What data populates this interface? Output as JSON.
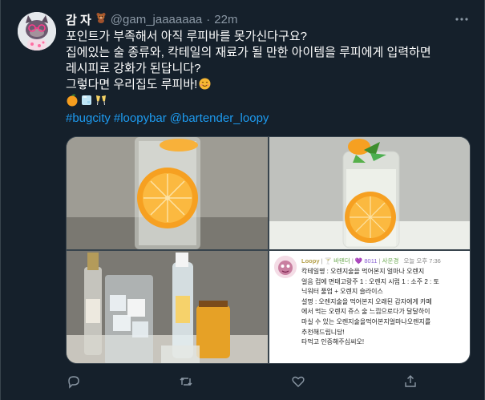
{
  "tweet": {
    "display_name": "감 자",
    "name_emoji": "bear-emoji",
    "handle": "@gam_jaaaaaaa",
    "separator": "·",
    "time": "22m",
    "lines": [
      "포인트가 부족해서 아직 루피바를 못가신다구요?",
      "집에있는 술 종류와, 칵테일의 재료가 될 만한 아이템을 루피에게 입력하면",
      "레시피로 강화가 된답니다?",
      "그렇다면 우리집도 루피바!"
    ],
    "emoji_line_icons": [
      "orange-emoji",
      "ice-cube-emoji",
      "clinking-glasses-emoji"
    ],
    "hashtags": [
      "#bugcity",
      "#loopybar",
      "@bartender_loopy"
    ]
  },
  "chat_card": {
    "name": "Loopy",
    "badge_1": "바텐더",
    "badge_2": "8011",
    "badge_3": "사운경",
    "timestamp": "오늘 오후 7:36",
    "lines": [
      "칵테일명 : 오렌지술을 먹어본지 얼마나 오렌지",
      "얼음 컵에 면태고랑주 1 : 오렌지 시럽 1 : 소주 2 : 토",
      "닉워터 풀업 + 오렌지 슬라이스",
      "설명 : 오렌지술을 먹어본지 오래된 감자에게 카페",
      "에서 먹는 오렌지 쥬스 술 느낌으로다가 달달하이",
      "마실 수 있는 오렌지술을먹어본지얼마나오렌지를",
      "추천해드립니당!",
      "타먹고 인증해주십씨오!"
    ]
  },
  "colors": {
    "background": "#15202b",
    "secondary_text": "#8b98a5",
    "link": "#1d9bf0",
    "border": "#38444d"
  }
}
